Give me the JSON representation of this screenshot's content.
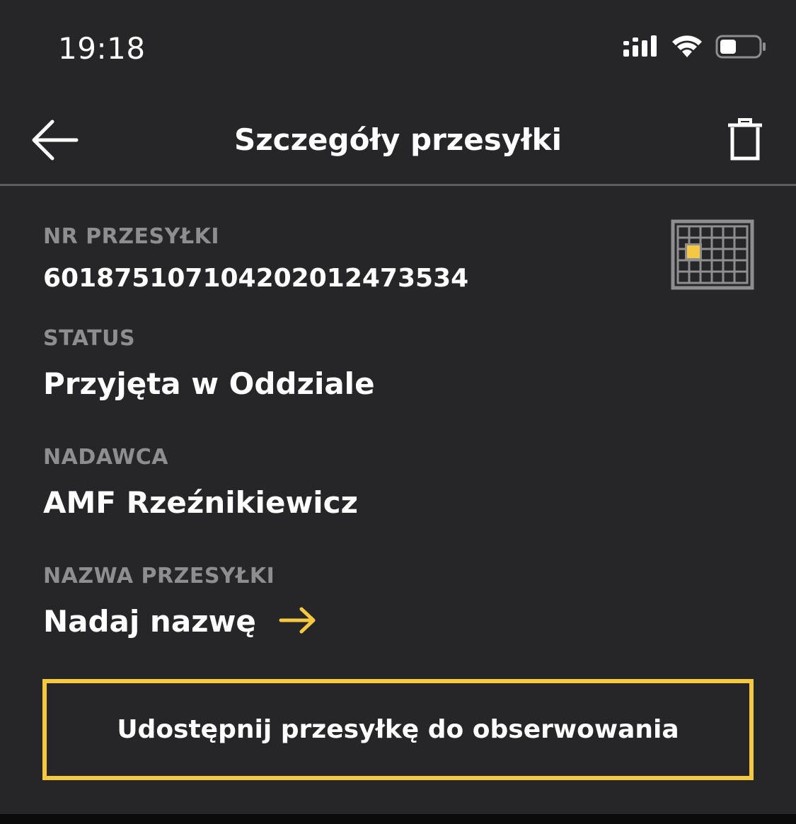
{
  "status_bar": {
    "time": "19:18",
    "icons": [
      "cellular-signal-icon",
      "wifi-icon",
      "battery-icon"
    ]
  },
  "header": {
    "title": "Szczegóły przesyłki",
    "back_icon": "arrow-left-icon",
    "delete_icon": "trash-icon"
  },
  "details": {
    "number_label": "NR PRZESYŁKI",
    "number_value": "6018751071042020124735­34",
    "status_label": "STATUS",
    "status_value": "Przyjęta w Oddziale",
    "sender_label": "NADAWCA",
    "sender_value": "AMF Rzeźnikiewicz",
    "name_label": "NAZWA PRZESYŁKI",
    "name_link": "Nadaj nazwę",
    "name_link_icon": "arrow-right-icon",
    "qr_icon": "grid-code-icon"
  },
  "share_button": {
    "label": "Udostępnij przesyłkę do obserwowania"
  },
  "colors": {
    "background": "#262628",
    "accent": "#f5c842",
    "label_gray": "#8e8e90",
    "text": "#ffffff"
  }
}
